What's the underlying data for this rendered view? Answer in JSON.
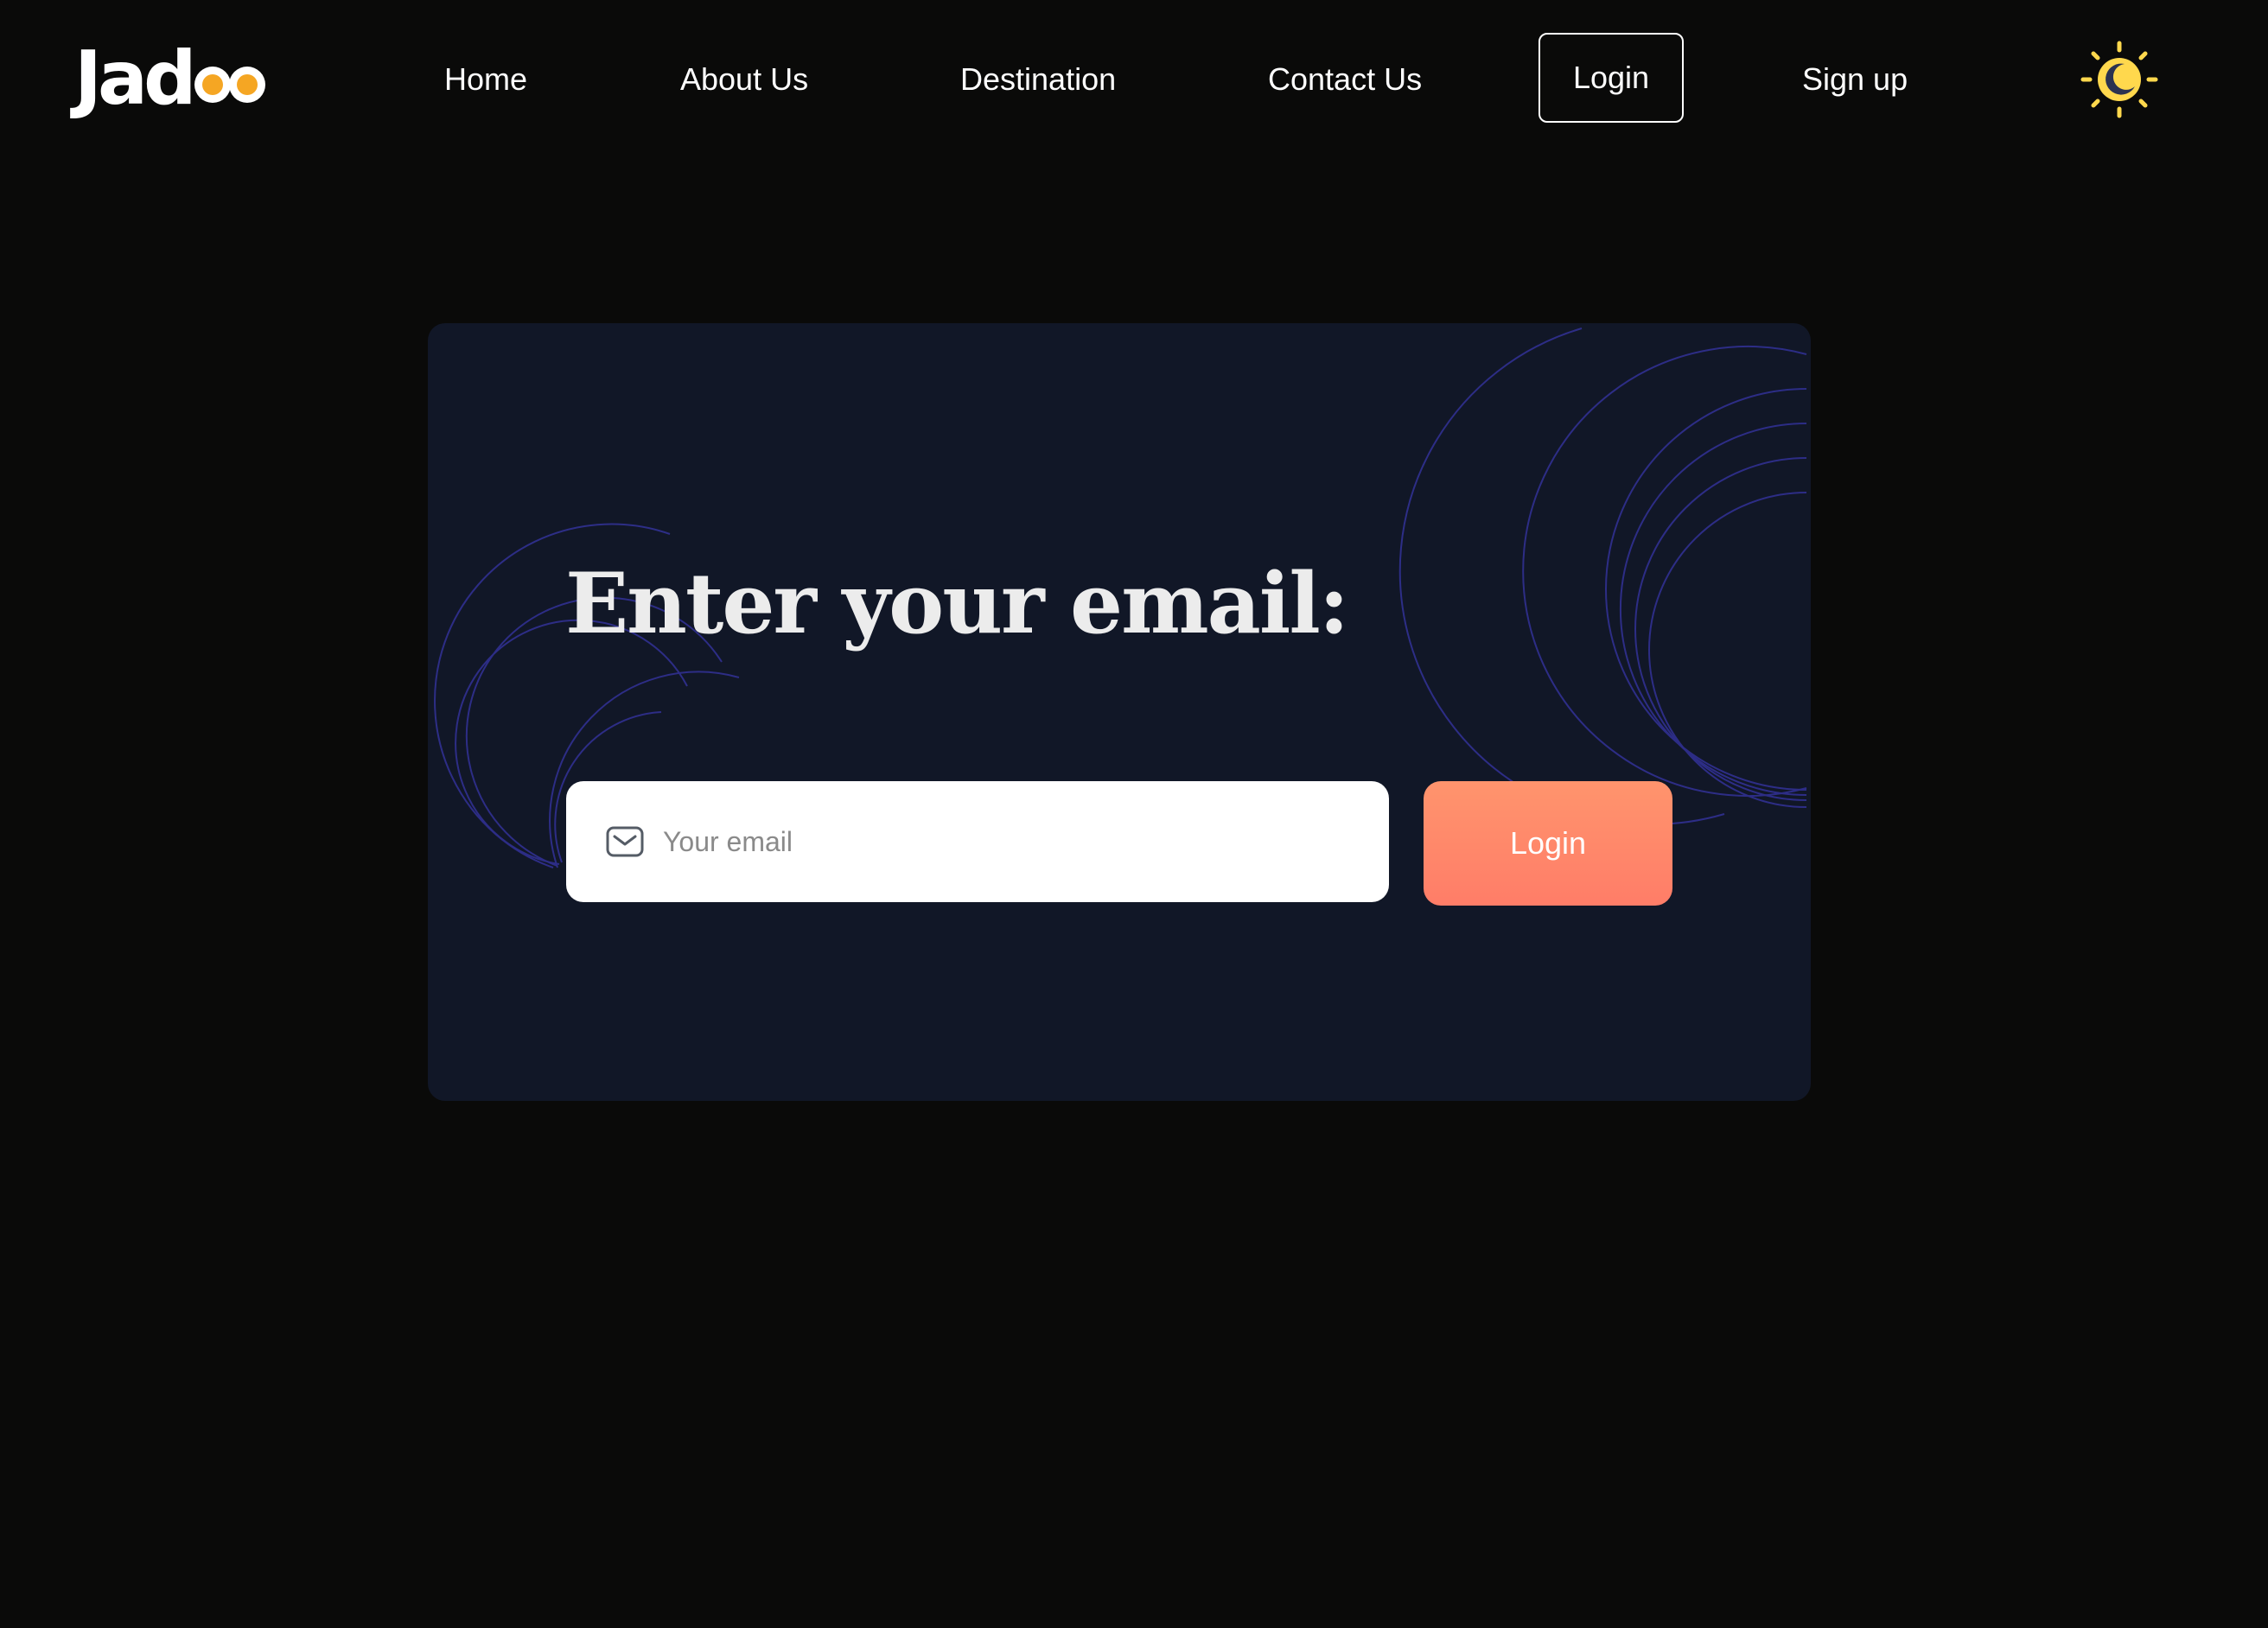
{
  "header": {
    "logo": {
      "text": "Jad",
      "dot_color": "#f5a623"
    },
    "nav": [
      {
        "label": "Home"
      },
      {
        "label": "About Us"
      },
      {
        "label": "Destination"
      },
      {
        "label": "Contact Us"
      },
      {
        "label": "Login"
      },
      {
        "label": "Sign up"
      }
    ],
    "theme_icon": "sun-moon-icon",
    "theme_color": "#ffd84d"
  },
  "card": {
    "title": "Enter your email:",
    "email": {
      "placeholder": "Your email",
      "value": "",
      "icon": "mail-icon"
    },
    "submit_label": "Login",
    "colors": {
      "background": "#111727",
      "button": "#ff8a6a",
      "decoration": "#2f2f8c"
    }
  }
}
